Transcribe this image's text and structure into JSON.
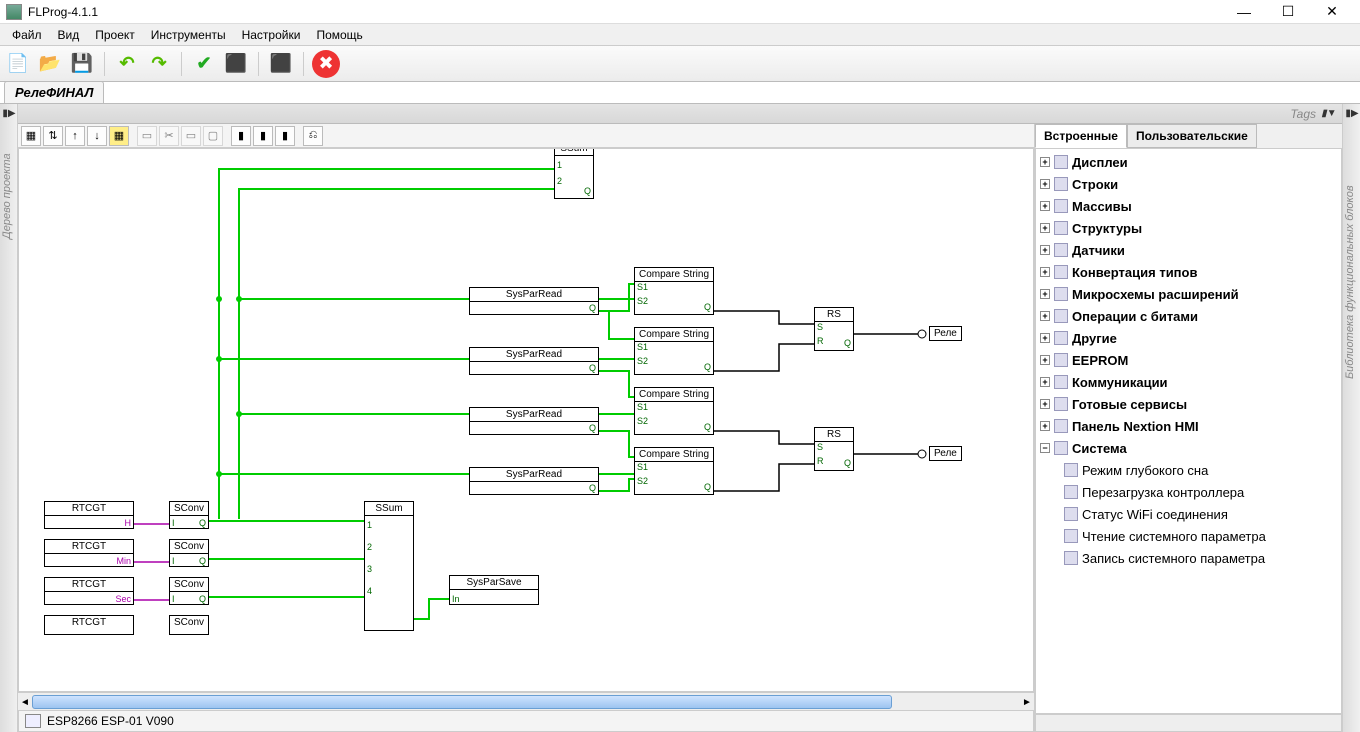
{
  "window": {
    "title": "FLProg-4.1.1"
  },
  "menu": [
    "Файл",
    "Вид",
    "Проект",
    "Инструменты",
    "Настройки",
    "Помощь"
  ],
  "toolbar_icons": {
    "new": "📄",
    "open": "📂",
    "save": "💾",
    "undo": "↶",
    "redo": "↷",
    "check": "✔",
    "compile": "⬛",
    "upload": "⬛",
    "cancel": "✖"
  },
  "tab": {
    "label": "РелеФИНАЛ"
  },
  "tags_label": "Tags",
  "left_panel_label": "Дерево проекта",
  "right_panel_label": "Библиотека функциональных блоков",
  "status": {
    "board": "ESP8266 ESP-01 V090"
  },
  "lib_tabs": {
    "builtin": "Встроенные",
    "user": "Пользовательские"
  },
  "lib_tree": [
    {
      "label": "Дисплеи"
    },
    {
      "label": "Строки"
    },
    {
      "label": "Массивы"
    },
    {
      "label": "Структуры"
    },
    {
      "label": "Датчики"
    },
    {
      "label": "Конвертация типов"
    },
    {
      "label": "Микросхемы расширений"
    },
    {
      "label": "Операции с битами"
    },
    {
      "label": "Другие"
    },
    {
      "label": "EEPROM"
    },
    {
      "label": "Коммуникации"
    },
    {
      "label": "Готовые сервисы"
    },
    {
      "label": "Панель Nextion HMI"
    },
    {
      "label": "Система",
      "expanded": true,
      "children": [
        "Режим глубокого сна",
        "Перезагрузка контроллера",
        "Статус WiFi соединения",
        "Чтение системного параметра",
        "Запись системного параметра"
      ]
    }
  ],
  "blocks": {
    "ssum_top": "SSum",
    "ssum_mid": "SSum",
    "syspar_read": "SysParRead",
    "syspar_save": "SysParSave",
    "compare": "Compare String",
    "rs": "RS",
    "rtcgt": "RTCGT",
    "sconv": "SConv",
    "relay": "Реле",
    "q": "Q",
    "s": "S",
    "r": "R",
    "s1": "S1",
    "s2": "S2",
    "i": "I",
    "in": "In",
    "h": "H",
    "min": "Min",
    "sec": "Sec",
    "p1": "1",
    "p2": "2",
    "p3": "3",
    "p4": "4"
  }
}
